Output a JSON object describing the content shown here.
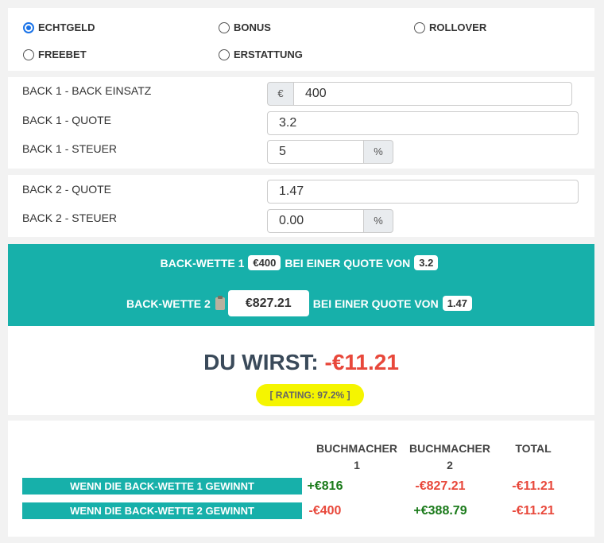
{
  "mode_options": [
    {
      "label": "ECHTGELD",
      "checked": true
    },
    {
      "label": "BONUS",
      "checked": false
    },
    {
      "label": "ROLLOVER",
      "checked": false
    },
    {
      "label": "FREEBET",
      "checked": false
    },
    {
      "label": "ERSTATTUNG",
      "checked": false
    }
  ],
  "back1": {
    "stake_label": "BACK 1 - BACK EINSATZ",
    "currency": "€",
    "stake_value": "400",
    "odds_label": "BACK 1 - QUOTE",
    "odds_value": "3.2",
    "tax_label": "BACK 1 - STEUER",
    "tax_value": "5",
    "tax_unit": "%"
  },
  "back2": {
    "odds_label": "BACK 2 - QUOTE",
    "odds_value": "1.47",
    "tax_label": "BACK 2 - STEUER",
    "tax_value": "0.00",
    "tax_unit": "%"
  },
  "summary": {
    "line1_prefix": "BACK-WETTE 1",
    "line1_amount": "€400",
    "line1_mid": "BEI EINER QUOTE VON",
    "line1_odds": "3.2",
    "line2_prefix": "BACK-WETTE 2",
    "line2_amount": "€827.21",
    "line2_mid": "BEI EINER QUOTE VON",
    "line2_odds": "1.47"
  },
  "result": {
    "label": "DU WIRST:",
    "value": "-€11.21",
    "rating": "[ RATING: 97.2% ]"
  },
  "table": {
    "headers": [
      "BUCHMACHER 1",
      "BUCHMACHER 2",
      "TOTAL"
    ],
    "rows": [
      {
        "label": "WENN DIE BACK-WETTE 1 GEWINNT",
        "values": [
          "+€816",
          "-€827.21",
          "-€11.21"
        ]
      },
      {
        "label": "WENN DIE BACK-WETTE 2 GEWINNT",
        "values": [
          "-€400",
          "+€388.79",
          "-€11.21"
        ]
      }
    ]
  },
  "colors": {
    "teal": "#17b0aa",
    "positive": "#1a7a1a",
    "negative": "#e8483b",
    "highlight": "#f5f500",
    "radio_selected": "#1a73e8"
  }
}
